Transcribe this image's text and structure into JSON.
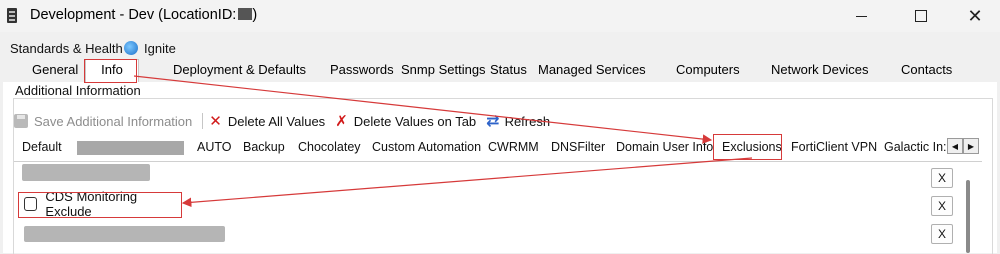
{
  "window": {
    "title": "Development - Dev   (LocationID:",
    "title_suffix": ")",
    "minimize_icon": "minimize-icon",
    "maximize_icon": "maximize-icon",
    "close_icon": "close-icon"
  },
  "top_tabs": [
    {
      "label": "Standards & Health"
    },
    {
      "label": "Ignite",
      "icon": "globe-icon"
    }
  ],
  "main_tabs": [
    {
      "label": "General"
    },
    {
      "label": "Info",
      "selected": true
    },
    {
      "label": "Deployment & Defaults"
    },
    {
      "label": "Passwords"
    },
    {
      "label": "Snmp Settings"
    },
    {
      "label": "Status"
    },
    {
      "label": "Managed Services"
    },
    {
      "label": "Computers"
    },
    {
      "label": "Network Devices"
    },
    {
      "label": "Contacts"
    }
  ],
  "group": {
    "title": "Additional Information"
  },
  "toolbar": {
    "save_label": "Save Additional Information",
    "delete_all_label": "Delete All Values",
    "delete_tab_label": "Delete Values on Tab",
    "refresh_label": "Refresh"
  },
  "sub_tabs": [
    {
      "label": "Default"
    },
    {
      "label": "AUTO"
    },
    {
      "label": "Backup"
    },
    {
      "label": "Chocolatey"
    },
    {
      "label": "Custom Automation"
    },
    {
      "label": "CWRMM"
    },
    {
      "label": "DNSFilter"
    },
    {
      "label": "Domain User Info"
    },
    {
      "label": "Exclusions",
      "selected": true
    },
    {
      "label": "FortiClient VPN"
    },
    {
      "label": "Galactic In:"
    }
  ],
  "fields": {
    "checkbox_label": "CDS Monitoring Exclude",
    "remove_label": "X"
  },
  "colors": {
    "highlight": "#d63a3a",
    "accent_refresh": "#2e63c9",
    "delete_red": "#d11a1a"
  }
}
